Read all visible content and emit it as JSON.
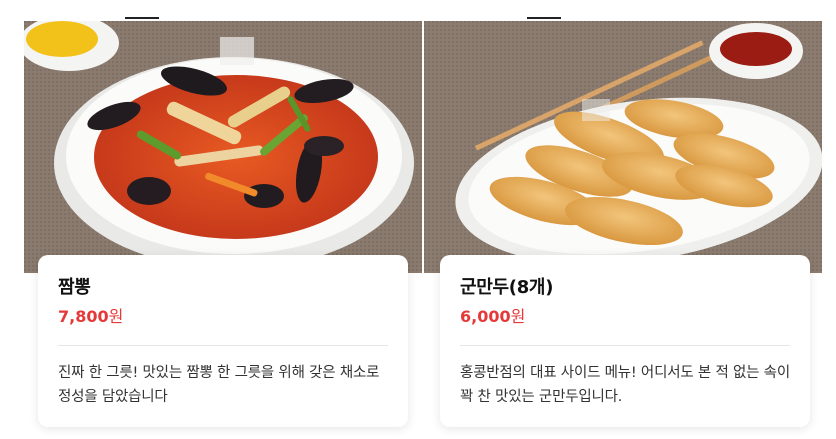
{
  "menu_items": [
    {
      "name": "짬뽕",
      "price_number": "7,800",
      "price_unit": "원",
      "description": "진짜 한 그릇! 맛있는 짬뽕 한 그릇을 위해 갖은 채소로 정성을 담았습니다",
      "image_icon": "jjamppong-bowl-image"
    },
    {
      "name": "군만두(8개)",
      "price_number": "6,000",
      "price_unit": "원",
      "description": "홍콩반점의 대표 사이드 메뉴! 어디서도 본 적 없는 속이 꽉 찬 맛있는 군만두입니다.",
      "image_icon": "fried-dumplings-image"
    }
  ],
  "colors": {
    "price": "#e53939",
    "table_cloth": "#8a7a6c",
    "soup": "#d8431c"
  }
}
